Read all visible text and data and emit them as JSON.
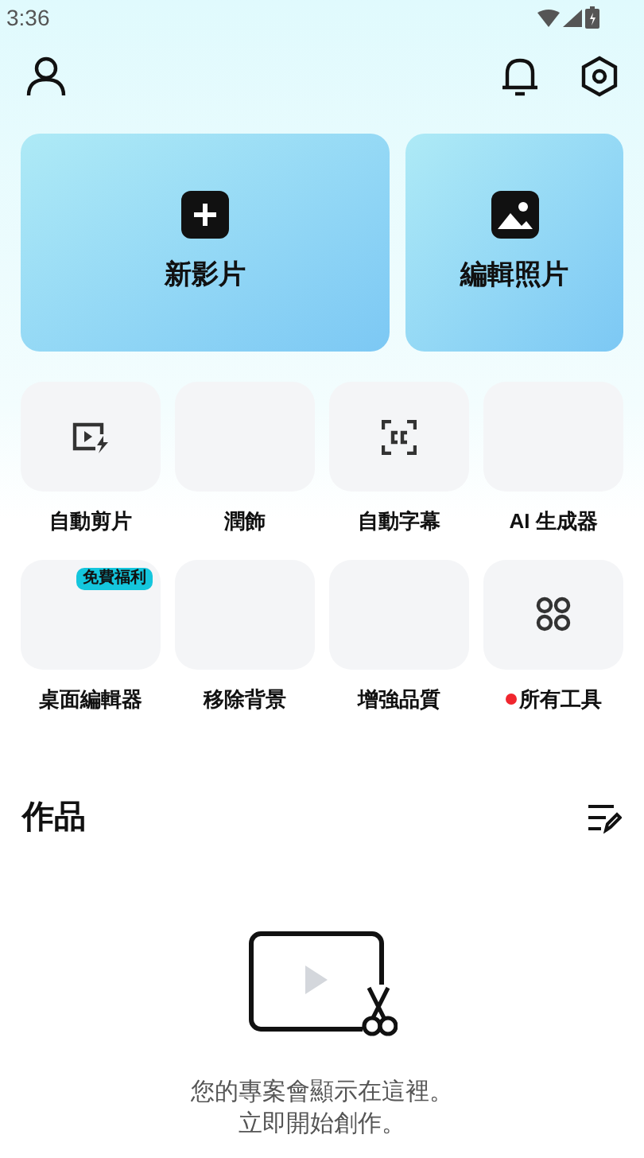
{
  "status_bar": {
    "time": "3:36"
  },
  "primary_actions": [
    {
      "label": "新影片",
      "kind": "new-video"
    },
    {
      "label": "編輯照片",
      "kind": "edit-photo"
    }
  ],
  "tools": [
    {
      "label": "自動剪片",
      "kind": "auto-cut"
    },
    {
      "label": "潤飾",
      "kind": "blank"
    },
    {
      "label": "自動字幕",
      "kind": "captions"
    },
    {
      "label": "AI 生成器",
      "kind": "blank"
    },
    {
      "label": "桌面編輯器",
      "kind": "blank",
      "badge": "免費福利"
    },
    {
      "label": "移除背景",
      "kind": "blank"
    },
    {
      "label": "增強品質",
      "kind": "blank"
    },
    {
      "label": "所有工具",
      "kind": "all-tools",
      "new_dot": true
    }
  ],
  "projects": {
    "title": "作品",
    "empty_message": [
      "您的專案會顯示在這裡。",
      "立即開始創作。"
    ]
  }
}
